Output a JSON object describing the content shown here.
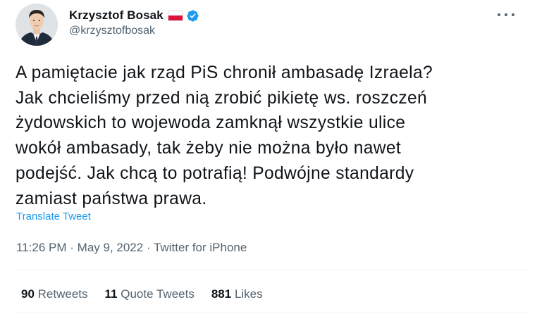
{
  "author": {
    "display_name": "Krzysztof Bosak",
    "handle": "@krzysztofbosak",
    "flag_icon": "poland-flag-icon",
    "verified_icon": "verified-badge-icon",
    "verified_color": "#1d9bf0"
  },
  "menu": {
    "icon": "more-options-icon"
  },
  "tweet": {
    "lines": [
      "A pamiętacie jak rząd PiS chronił ambasadę Izraela?",
      "Jak chcieliśmy przed nią zrobić pikietę ws. roszczeń",
      "żydowskich to wojewoda zamknął wszystkie ulice",
      "wokół ambasady, tak żeby nie można było nawet",
      "podejść. Jak chcą to potrafią! Podwójne standardy",
      "zamiast państwa prawa."
    ],
    "translate_label": "Translate Tweet",
    "time": "11:26 PM",
    "separator": "·",
    "date": "May 9, 2022",
    "source": "Twitter for iPhone"
  },
  "stats": {
    "retweets_count": "90",
    "retweets_label": "Retweets",
    "quotes_count": "11",
    "quotes_label": "Quote Tweets",
    "likes_count": "881",
    "likes_label": "Likes"
  },
  "colors": {
    "link": "#1d9bf0",
    "secondary_text": "#536471",
    "primary_text": "#0f1419"
  }
}
